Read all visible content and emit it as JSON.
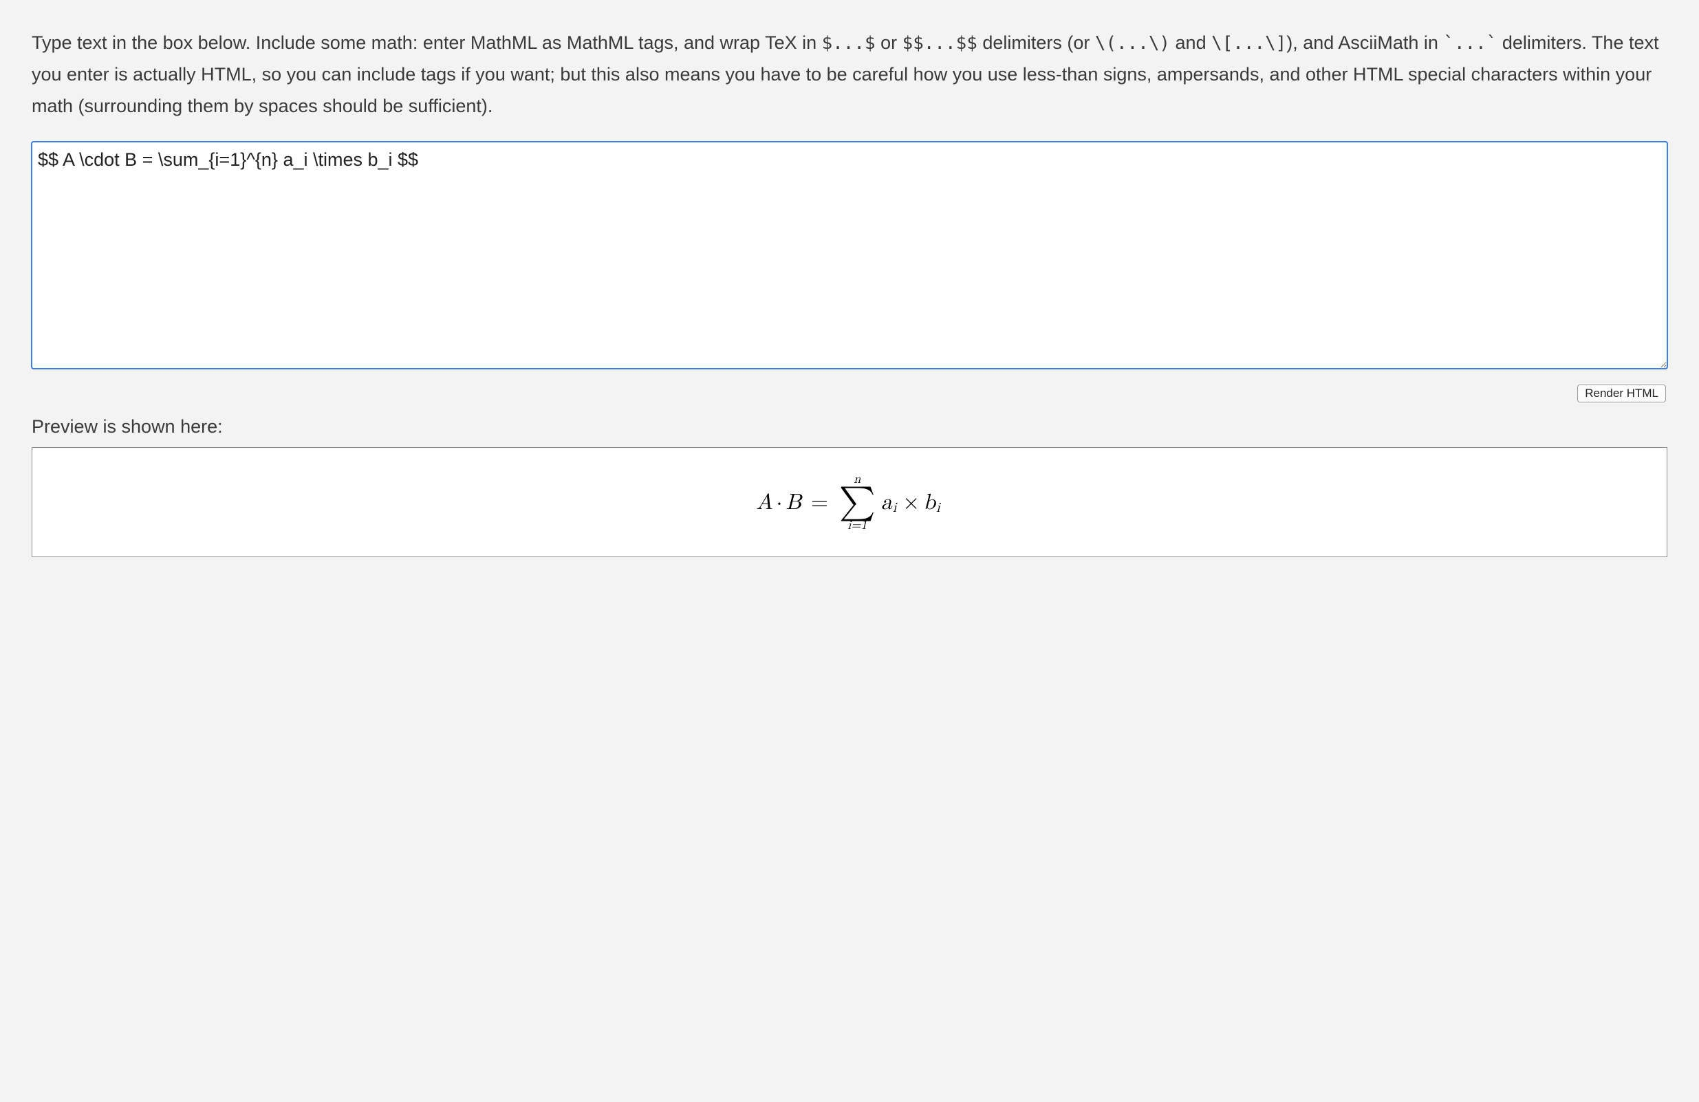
{
  "instructions": {
    "pre1": "Type text in the box below. Include some math: enter MathML as MathML tags, and wrap TeX in ",
    "delim1": "$...$",
    "mid1": " or ",
    "delim2": "$$...$$",
    "mid2": " delimiters (or ",
    "delim3": "\\(...\\)",
    "mid3": " and ",
    "delim4": "\\[...\\]",
    "mid4": "), and AsciiMath in ",
    "delim5": "`...`",
    "post": " delimiters. The text you enter is actually HTML, so you can include tags if you want; but this also means you have to be careful how you use less-than signs, ampersands, and other HTML special characters within your math (surrounding them by spaces should be sufficient)."
  },
  "input": {
    "value": "$$ A \\cdot B = \\sum_{i=1}^{n} a_i \\times b_i $$"
  },
  "buttons": {
    "render": "Render HTML"
  },
  "preview": {
    "label": "Preview is shown here:",
    "formula": {
      "A": "A",
      "dot": "·",
      "B": "B",
      "eq": "=",
      "sum_upper": "n",
      "sum_symbol": "∑",
      "sum_lower": "i=1",
      "a": "a",
      "sub_i_1": "i",
      "times": "×",
      "b": "b",
      "sub_i_2": "i"
    }
  }
}
